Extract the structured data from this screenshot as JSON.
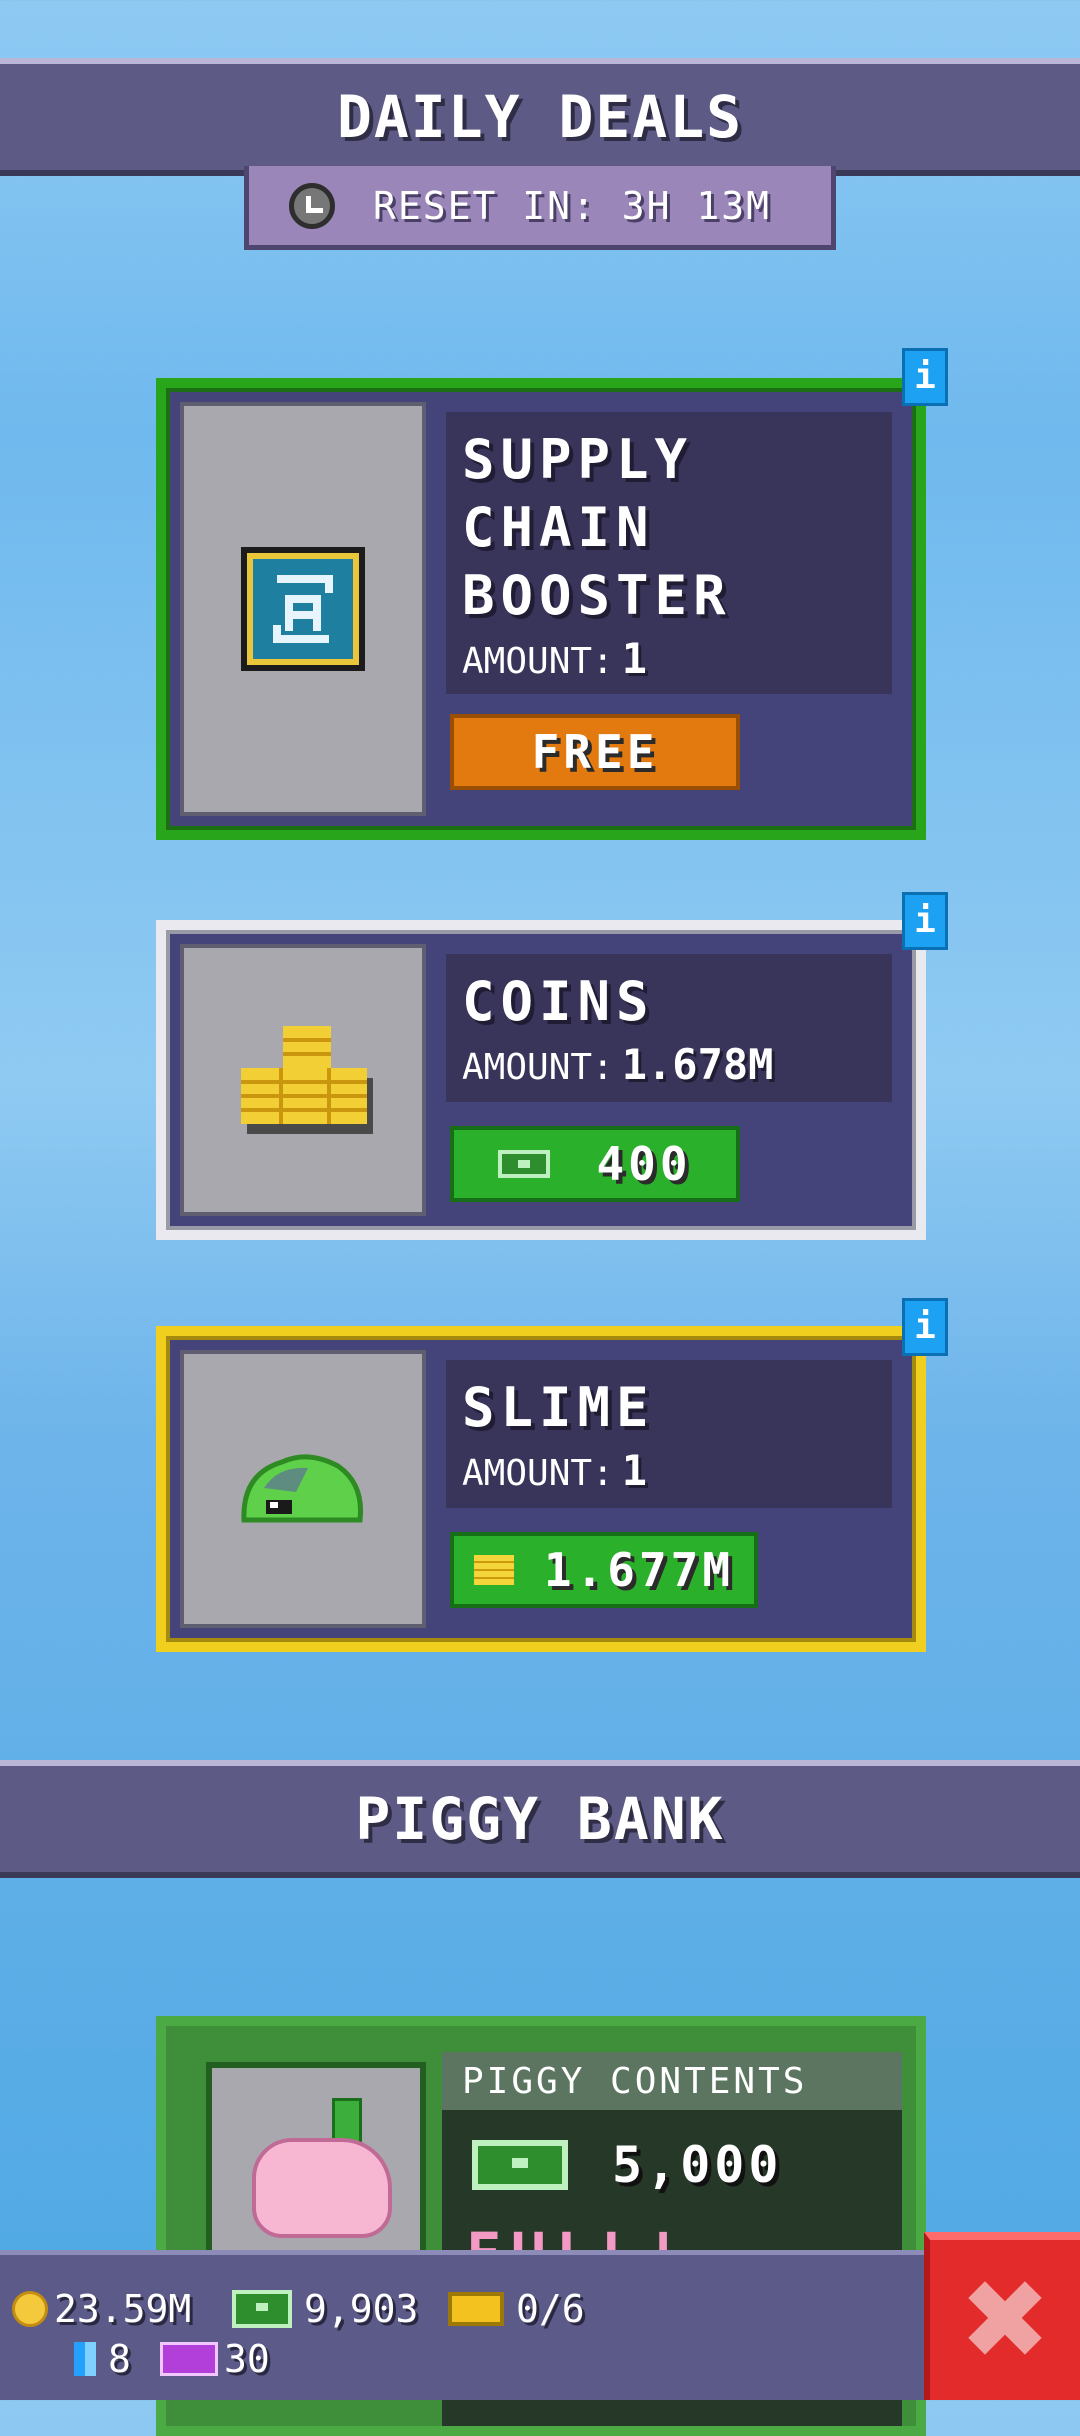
{
  "daily_deals": {
    "title": "DAILY DEALS",
    "reset_text": "RESET IN: 3H 13M",
    "deals": [
      {
        "name": "SUPPLY\nCHAIN\nBOOSTER",
        "amount_label": "AMOUNT:",
        "amount": "1",
        "price": "FREE",
        "price_icon": "none",
        "rarity_color": "#28a51b",
        "image_icon": "supply-chain-booster-icon"
      },
      {
        "name": "COINS",
        "amount_label": "AMOUNT:",
        "amount": "1.678M",
        "price": "400",
        "price_icon": "cash-icon",
        "rarity_color": "#e9e9ef",
        "image_icon": "coin-stack-icon"
      },
      {
        "name": "SLIME",
        "amount_label": "AMOUNT:",
        "amount": "1",
        "price": "1.677M",
        "price_icon": "coin-stack-icon",
        "rarity_color": "#f1cf1f",
        "image_icon": "slime-icon"
      }
    ],
    "info_icon_label": "i"
  },
  "piggy_bank": {
    "title": "PIGGY BANK",
    "contents_label": "PIGGY CONTENTS",
    "amount": "5,000",
    "status": "FULL!"
  },
  "resources": {
    "coins": "23.59M",
    "cash": "9,903",
    "tickets": "0/6",
    "gems": "8",
    "purple": "30"
  },
  "close_button": "✖"
}
